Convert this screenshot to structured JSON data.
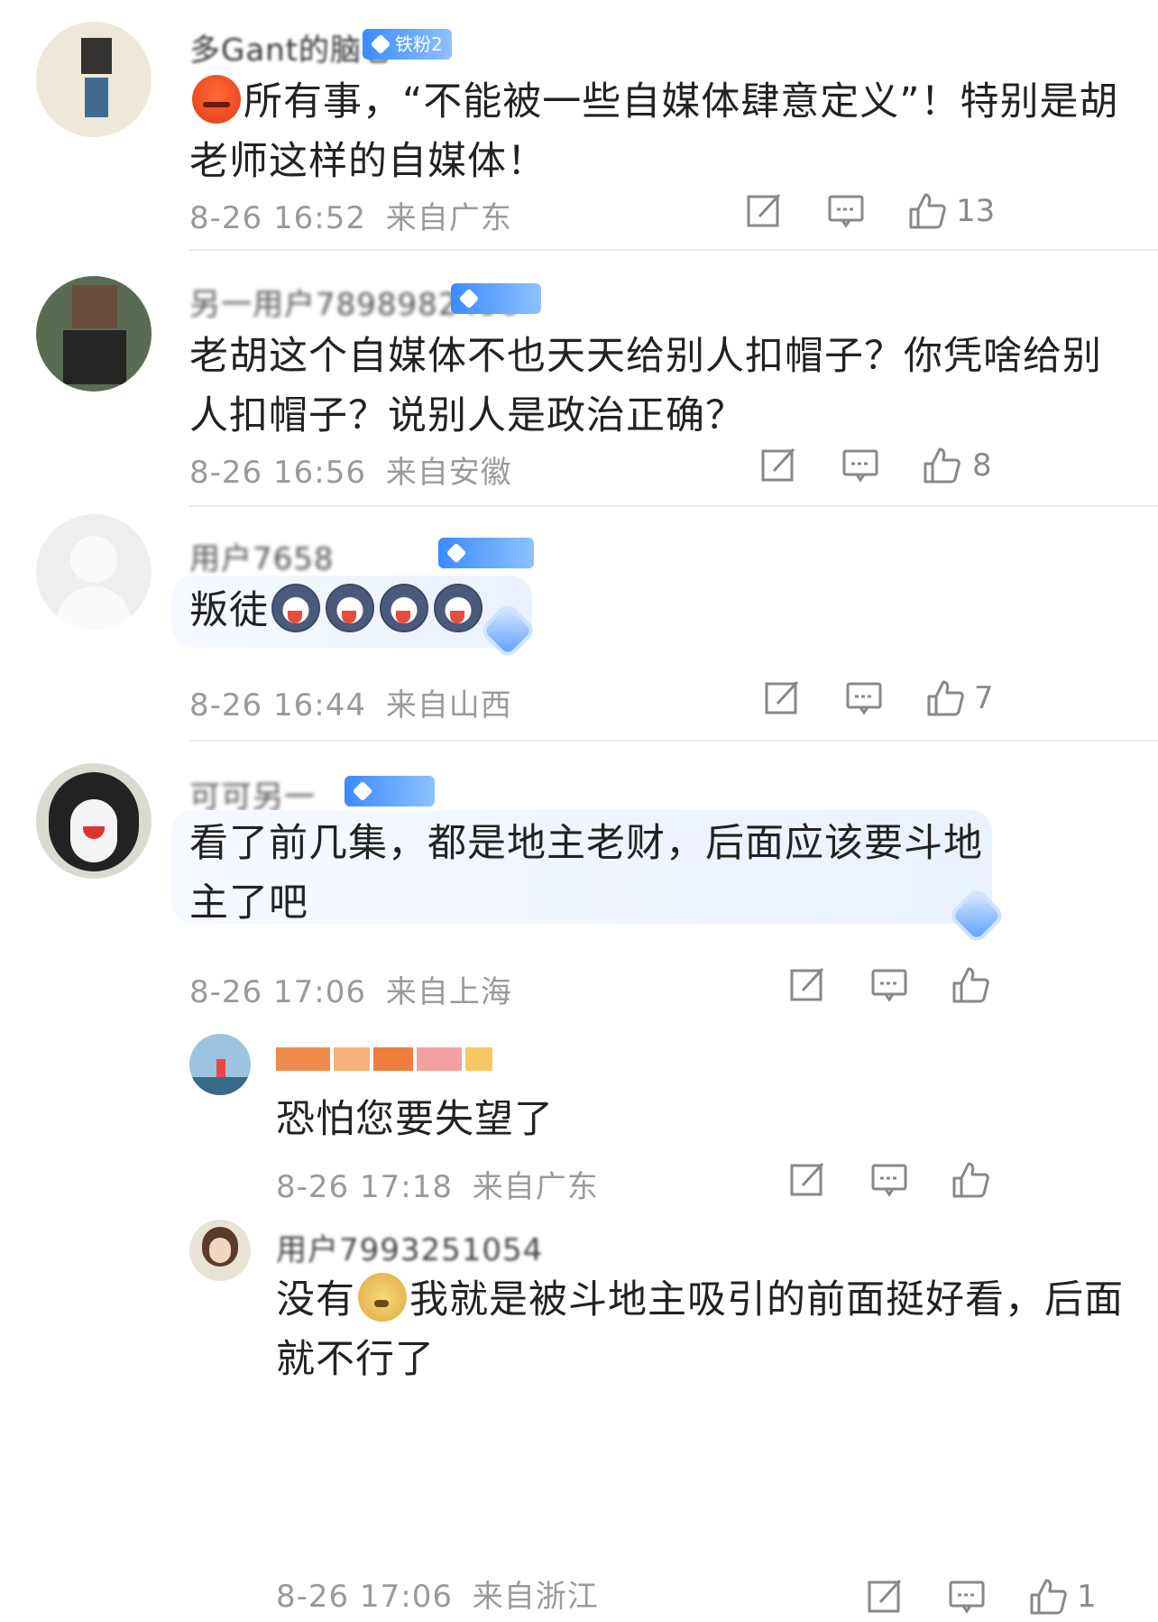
{
  "comments": [
    {
      "username": "多Gant的脑卷",
      "badge": "铁粉2",
      "text": "所有事，“不能被一些自媒体肆意定义”！特别是胡老师这样的自媒体！",
      "time": "8-26 16:52",
      "location": "来自广东",
      "likes": "13"
    },
    {
      "username": "另一用户7898982496",
      "text": "老胡这个自媒体不也天天给别人扣帽子？你凭啥给别人扣帽子？说别人是政治正确？",
      "time": "8-26 16:56",
      "location": "来自安徽",
      "likes": "8"
    },
    {
      "username": "用户7658",
      "text": "叛徒",
      "time": "8-26 16:44",
      "location": "来自山西",
      "likes": "7"
    },
    {
      "username": "可可另一",
      "text": "看了前几集，都是地主老财，后面应该要斗地主了吧",
      "time": "8-26 17:06",
      "location": "来自上海",
      "likes": ""
    }
  ],
  "replies": [
    {
      "text": "恐怕您要失望了",
      "time": "8-26 17:18",
      "location": "来自广东"
    },
    {
      "username": "用户7993251054",
      "text_a": "没有",
      "text_b": "我就是被斗地主吸引的前面挺好看，后面就不行了",
      "time": "8-26 17:06",
      "location": "来自浙江",
      "likes": "1"
    }
  ],
  "icons": {
    "share": "share-icon",
    "comment": "comment-icon",
    "like": "thumbs-up-icon"
  },
  "colors": {
    "meta_text": "#9a9a9a",
    "badge": "#3a8bff",
    "bubble": "#eaf2ff"
  }
}
